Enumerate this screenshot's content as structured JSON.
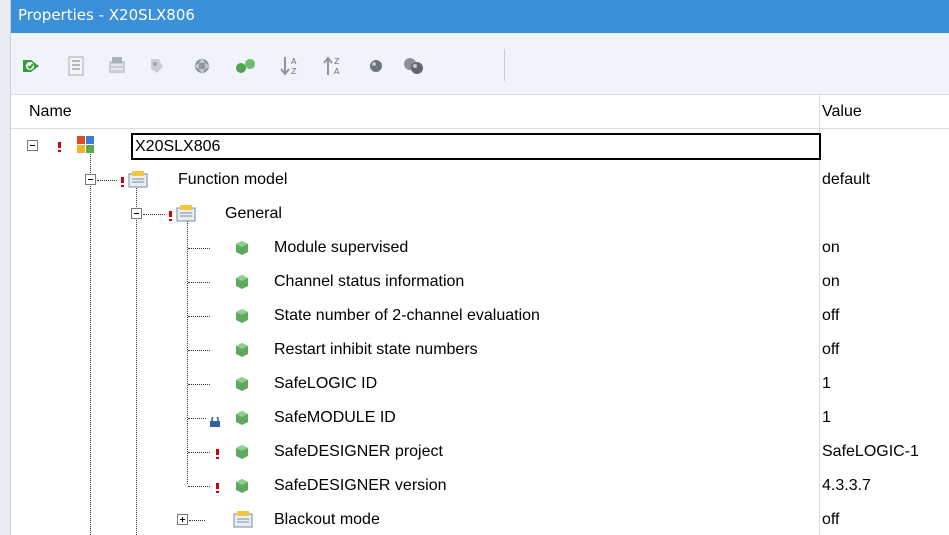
{
  "window": {
    "title": "Properties - X20SLX806"
  },
  "toolbar": {
    "buttons": [
      "properties-refresh-icon",
      "categorized-icon",
      "alphabetical-icon",
      "property-pages-icon",
      "navigate-icon",
      "expand-all-icon",
      "sort-ascending-icon",
      "sort-descending-icon",
      "circle-icon",
      "multi-circle-icon"
    ]
  },
  "header": {
    "name_label": "Name",
    "value_label": "Value"
  },
  "tree": {
    "root": {
      "label": "X20SLX806",
      "value": ""
    },
    "rows": [
      {
        "label": "Function model",
        "value": "default"
      },
      {
        "label": "General",
        "value": ""
      },
      {
        "label": "Module supervised",
        "value": "on"
      },
      {
        "label": "Channel status information",
        "value": "on"
      },
      {
        "label": "State number of 2-channel evaluation",
        "value": "off"
      },
      {
        "label": "Restart inhibit state numbers",
        "value": "off"
      },
      {
        "label": "SafeLOGIC ID",
        "value": "1"
      },
      {
        "label": "SafeMODULE ID",
        "value": "1"
      },
      {
        "label": "SafeDESIGNER project",
        "value": "SafeLOGIC-1"
      },
      {
        "label": "SafeDESIGNER version",
        "value": "4.3.3.7"
      },
      {
        "label": "Blackout mode",
        "value": "off"
      }
    ]
  },
  "colors": {
    "titlebar": "#3c8fd9",
    "warning": "#d40000",
    "cube": "#5fa85f"
  }
}
